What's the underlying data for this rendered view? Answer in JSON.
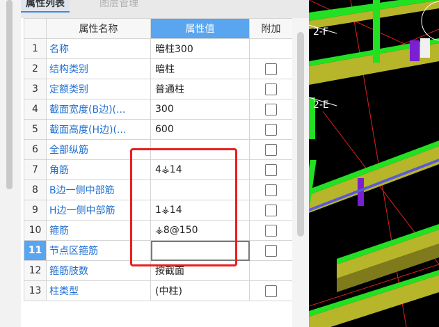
{
  "tabs": [
    {
      "label": "属性列表",
      "active": true
    },
    {
      "label": "图层管理",
      "active": false
    }
  ],
  "table": {
    "columns": [
      "属性名称",
      "属性值",
      "附加"
    ],
    "rows": [
      {
        "num": "1",
        "name": "名称",
        "value": "暗柱300",
        "checkbox": false
      },
      {
        "num": "2",
        "name": "结构类别",
        "value": "暗柱",
        "checkbox": true
      },
      {
        "num": "3",
        "name": "定额类别",
        "value": "普通柱",
        "checkbox": true
      },
      {
        "num": "4",
        "name": "截面宽度(B边)(...",
        "value": "300",
        "checkbox": true
      },
      {
        "num": "5",
        "name": "截面高度(H边)(...",
        "value": "600",
        "checkbox": true
      },
      {
        "num": "6",
        "name": "全部纵筋",
        "value": "",
        "checkbox": true
      },
      {
        "num": "7",
        "name": "角筋",
        "value": "4⚶14",
        "checkbox": true
      },
      {
        "num": "8",
        "name": "B边一侧中部筋",
        "value": "",
        "checkbox": true
      },
      {
        "num": "9",
        "name": "H边一侧中部筋",
        "value": "1⚶14",
        "checkbox": true
      },
      {
        "num": "10",
        "name": "箍筋",
        "value": "⚶8@150",
        "checkbox": true
      },
      {
        "num": "11",
        "name": "节点区箍筋",
        "value": "",
        "checkbox": true,
        "selected": true
      },
      {
        "num": "12",
        "name": "箍筋肢数",
        "value": "按截面",
        "checkbox": false
      },
      {
        "num": "13",
        "name": "柱类型",
        "value": "(中柱)",
        "checkbox": true
      }
    ]
  },
  "viewport": {
    "labels": [
      "2-F",
      "2-E"
    ],
    "colors": {
      "beam_green": "#22e022",
      "beam_yellow": "#b7b52a",
      "beam_olive": "#7f7a1c",
      "purple": "#7a1fd1",
      "red": "#e02020"
    }
  }
}
